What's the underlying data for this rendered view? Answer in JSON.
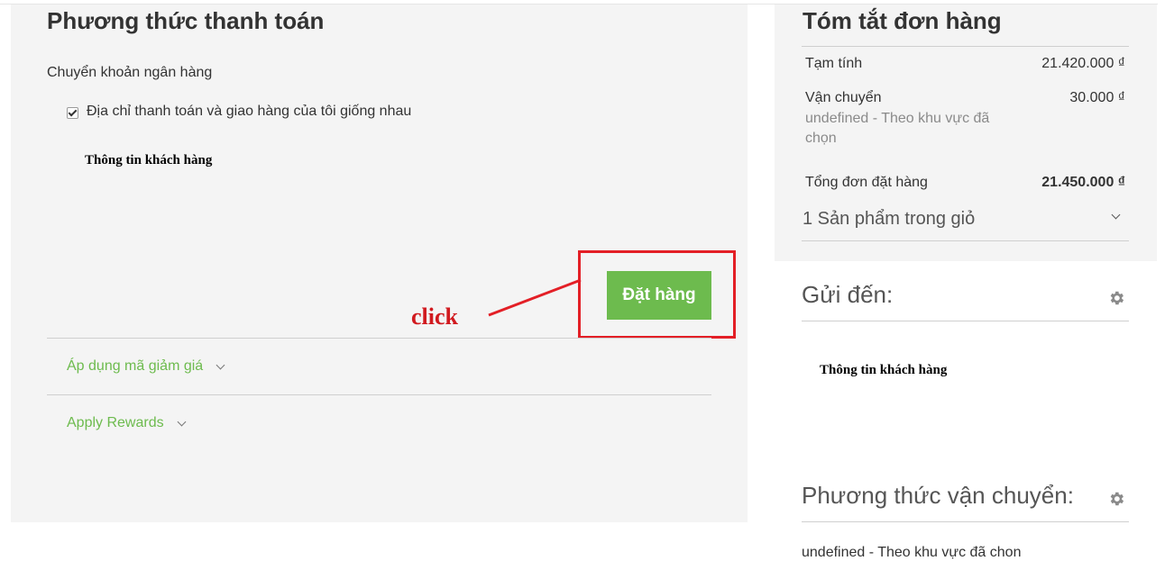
{
  "payment": {
    "title": "Phương thức thanh toán",
    "method": "Chuyển khoản ngân hàng",
    "same_address_label": "Địa chỉ thanh toán và giao hàng của tôi giống nhau",
    "same_address_checked": true,
    "customer_info": "Thông tin khách hàng",
    "place_order_label": "Đặt hàng",
    "discount_label": "Áp dụng mã giảm giá",
    "rewards_label": "Apply Rewards"
  },
  "annotation": {
    "click_label": "click",
    "color": "#e31f26"
  },
  "summary": {
    "title": "Tóm tắt đơn hàng",
    "subtotal_label": "Tạm tính",
    "subtotal_value": "21.420.000 ₫",
    "shipping_label": "Vận chuyển",
    "shipping_value": "30.000 ₫",
    "shipping_note": "undefined - Theo khu vực đã chọn",
    "total_label": "Tổng đơn đặt hàng",
    "total_value": "21.450.000 ₫",
    "cart_toggle": "1 Sản phẩm trong giỏ"
  },
  "ship_to": {
    "title": "Gửi đến:",
    "customer_info": "Thông tin khách hàng",
    "icon": "gear-icon"
  },
  "shipping_method": {
    "title": "Phương thức vận chuyển:",
    "value": "undefined - Theo khu vực đã chon",
    "icon": "gear-icon"
  },
  "colors": {
    "accent_green": "#6dbb4e",
    "panel_bg": "#f4f4f4"
  }
}
